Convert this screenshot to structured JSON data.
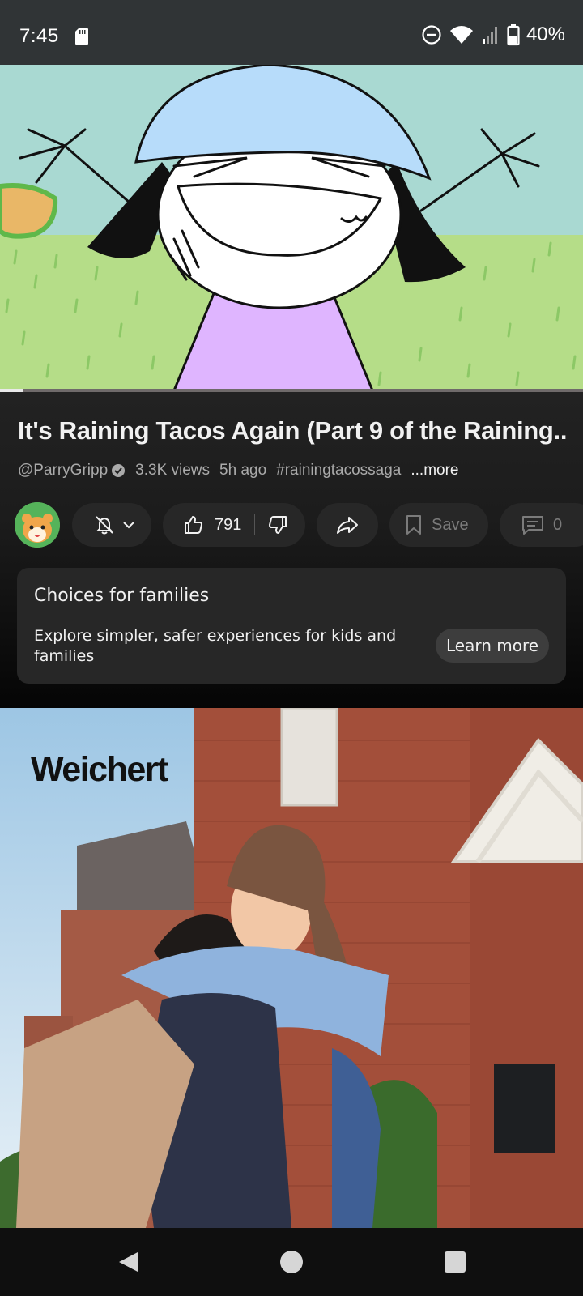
{
  "status_bar": {
    "time": "7:45",
    "battery": "40%",
    "icons": [
      "sd-card-icon",
      "do-not-disturb-icon",
      "wifi-icon",
      "cell-signal-icon",
      "battery-icon"
    ]
  },
  "player": {
    "progress": 0.04
  },
  "video": {
    "title": "It's Raining Tacos Again (Part 9 of the Raining..",
    "channel": "@ParryGripp",
    "views": "3.3K views",
    "age": "5h ago",
    "hashtag": "#rainingtacossaga",
    "more": "...more"
  },
  "actions": {
    "likes": "791",
    "save": "Save",
    "comments": "0"
  },
  "families_card": {
    "title": "Choices for families",
    "description": "Explore simpler, safer experiences for kids and families",
    "button": "Learn more"
  },
  "ad": {
    "brand": "Weichert"
  },
  "colors": {
    "background": "#0f0f0f",
    "pill": "#272727",
    "status_bar": "#303436",
    "sky": "#a9d9d2",
    "grass": "#b5dd88"
  }
}
